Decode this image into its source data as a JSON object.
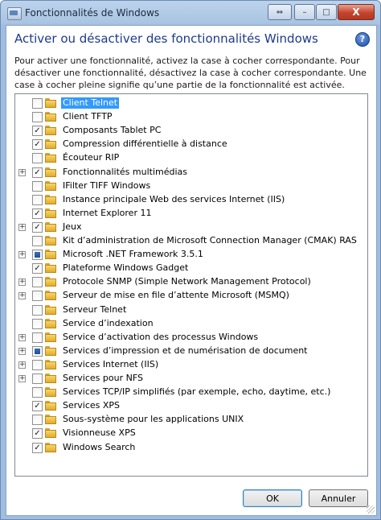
{
  "window": {
    "title": "Fonctionnalités de Windows",
    "controls": {
      "restore": "⇔",
      "minimize": "–",
      "maximize": "□",
      "close": "X"
    }
  },
  "heading": "Activer ou désactiver des fonctionnalités Windows",
  "help_symbol": "?",
  "description": "Pour activer une fonctionnalité, activez la case à cocher correspondante. Pour désactiver une fonctionnalité, désactivez la case à cocher correspondante. Une case à cocher pleine signifie qu’une partie de la fonctionnalité est activée.",
  "features": [
    {
      "label": "Client Telnet",
      "state": "unchecked",
      "expandable": false,
      "selected": true
    },
    {
      "label": "Client TFTP",
      "state": "unchecked",
      "expandable": false
    },
    {
      "label": "Composants Tablet PC",
      "state": "checked",
      "expandable": false
    },
    {
      "label": "Compression différentielle à distance",
      "state": "checked",
      "expandable": false
    },
    {
      "label": "Écouteur RIP",
      "state": "unchecked",
      "expandable": false
    },
    {
      "label": "Fonctionnalités multimédias",
      "state": "checked",
      "expandable": true
    },
    {
      "label": "IFilter TIFF Windows",
      "state": "unchecked",
      "expandable": false
    },
    {
      "label": "Instance principale Web des services Internet (IIS)",
      "state": "unchecked",
      "expandable": false
    },
    {
      "label": "Internet Explorer 11",
      "state": "checked",
      "expandable": false
    },
    {
      "label": "Jeux",
      "state": "checked",
      "expandable": true
    },
    {
      "label": "Kit d’administration de Microsoft Connection Manager (CMAK) RAS",
      "state": "unchecked",
      "expandable": false
    },
    {
      "label": "Microsoft .NET Framework 3.5.1",
      "state": "partial",
      "expandable": true
    },
    {
      "label": "Plateforme Windows Gadget",
      "state": "checked",
      "expandable": false
    },
    {
      "label": "Protocole SNMP (Simple Network Management Protocol)",
      "state": "unchecked",
      "expandable": true
    },
    {
      "label": "Serveur de mise en file d’attente Microsoft (MSMQ)",
      "state": "unchecked",
      "expandable": true
    },
    {
      "label": "Serveur Telnet",
      "state": "unchecked",
      "expandable": false
    },
    {
      "label": "Service d’indexation",
      "state": "unchecked",
      "expandable": false
    },
    {
      "label": "Service d’activation des processus Windows",
      "state": "unchecked",
      "expandable": true
    },
    {
      "label": "Services d’impression et de numérisation de document",
      "state": "partial",
      "expandable": true
    },
    {
      "label": "Services Internet (IIS)",
      "state": "unchecked",
      "expandable": true
    },
    {
      "label": "Services pour NFS",
      "state": "unchecked",
      "expandable": true
    },
    {
      "label": "Services TCP/IP simplifiés (par exemple, echo, daytime, etc.)",
      "state": "unchecked",
      "expandable": false
    },
    {
      "label": "Services XPS",
      "state": "checked",
      "expandable": false
    },
    {
      "label": "Sous-système pour les applications UNIX",
      "state": "unchecked",
      "expandable": false
    },
    {
      "label": "Visionneuse XPS",
      "state": "checked",
      "expandable": false
    },
    {
      "label": "Windows Search",
      "state": "checked",
      "expandable": false
    }
  ],
  "buttons": {
    "ok": "OK",
    "cancel": "Annuler"
  }
}
